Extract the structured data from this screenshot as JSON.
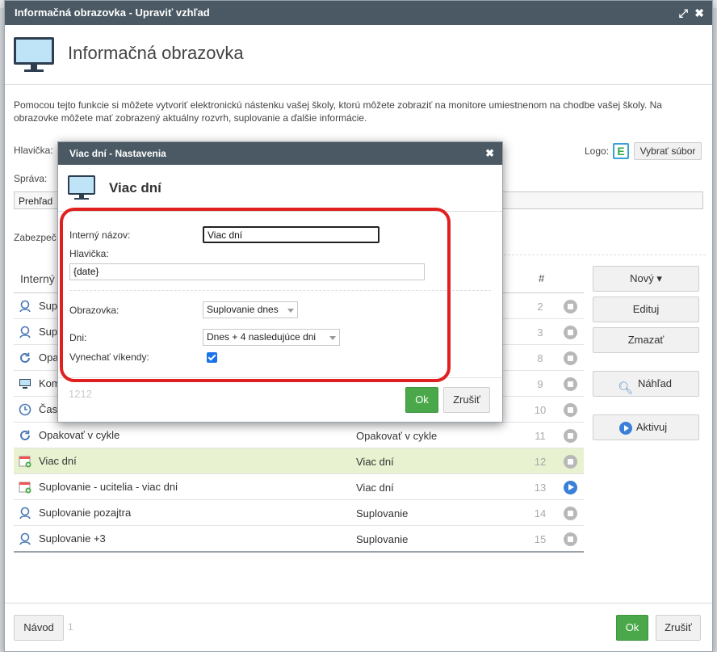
{
  "window": {
    "title": "Informačná obrazovka - Upraviť vzhľad",
    "heading": "Informačná obrazovka",
    "intro": "Pomocou tejto funkcie si môžete vytvoriť elektronickú nástenku vašej školy, ktorú môžete zobraziť na monitore umiestnenom na chodbe vašej školy. Na obrazovke môžete mať zobrazený aktuálny rozvrh, suplovanie a ďalšie informácie.",
    "hlavicka_label": "Hlavička:",
    "sprava_label": "Správa:",
    "sprava_value": "Prehľad",
    "zabezpecenie_label": "Zabezpeč",
    "logo_label": "Logo:",
    "logo_letter": "E",
    "select_file_label": "Vybrať súbor"
  },
  "table": {
    "col_name": "Interný",
    "col_num": "#",
    "rows": [
      {
        "name": "Sup",
        "type": "",
        "num": "2",
        "icon": "person-icon",
        "status": "stop"
      },
      {
        "name": "Sup",
        "type": "",
        "num": "3",
        "icon": "person-icon",
        "status": "stop"
      },
      {
        "name": "Opa",
        "type": "",
        "num": "8",
        "icon": "cycle-icon",
        "status": "stop"
      },
      {
        "name": "Kom",
        "type": "",
        "num": "9",
        "icon": "monitor-icon",
        "status": "stop"
      },
      {
        "name": "Čas",
        "type": "",
        "num": "10",
        "icon": "clock-icon",
        "status": "stop"
      },
      {
        "name": "Opakovať v cykle",
        "type": "Opakovať v cykle",
        "num": "11",
        "icon": "cycle-icon",
        "status": "stop"
      },
      {
        "name": "Viac dní",
        "type": "Viac dní",
        "num": "12",
        "icon": "calendar-icon",
        "status": "stop"
      },
      {
        "name": "Suplovanie - ucitelia - viac dni",
        "type": "Viac dní",
        "num": "13",
        "icon": "calendar-icon",
        "status": "play"
      },
      {
        "name": "Suplovanie pozajtra",
        "type": "Suplovanie",
        "num": "14",
        "icon": "person-icon",
        "status": "stop"
      },
      {
        "name": "Suplovanie +3",
        "type": "Suplovanie",
        "num": "15",
        "icon": "person-icon",
        "status": "stop"
      }
    ]
  },
  "side_buttons": {
    "new": "Nový ▾",
    "edit": "Edituj",
    "delete": "Zmazať",
    "preview": "Náhľad",
    "activate": "Aktivuj"
  },
  "footer": {
    "nav": "Návod",
    "page": "1",
    "ok": "Ok",
    "cancel": "Zrušiť"
  },
  "modal": {
    "title": "Viac dní - Nastavenia",
    "heading": "Viac dní",
    "internal_name_label": "Interný názov:",
    "internal_name_value": "Viac dní",
    "header_label": "Hlavička:",
    "header_value": "{date}",
    "screen_label": "Obrazovka:",
    "screen_value": "Suplovanie dnes",
    "days_label": "Dni:",
    "days_value": "Dnes + 4 nasledujúce dni",
    "skip_weekends_label": "Vynechať víkendy:",
    "skip_weekends_checked": true,
    "id_text": "1212",
    "ok": "Ok",
    "cancel": "Zrušiť"
  },
  "colors": {
    "titlebar": "#4a5963",
    "ok_green": "#4aa84a",
    "selected_row": "#e8f1d0",
    "highlight_red": "#e02020"
  }
}
